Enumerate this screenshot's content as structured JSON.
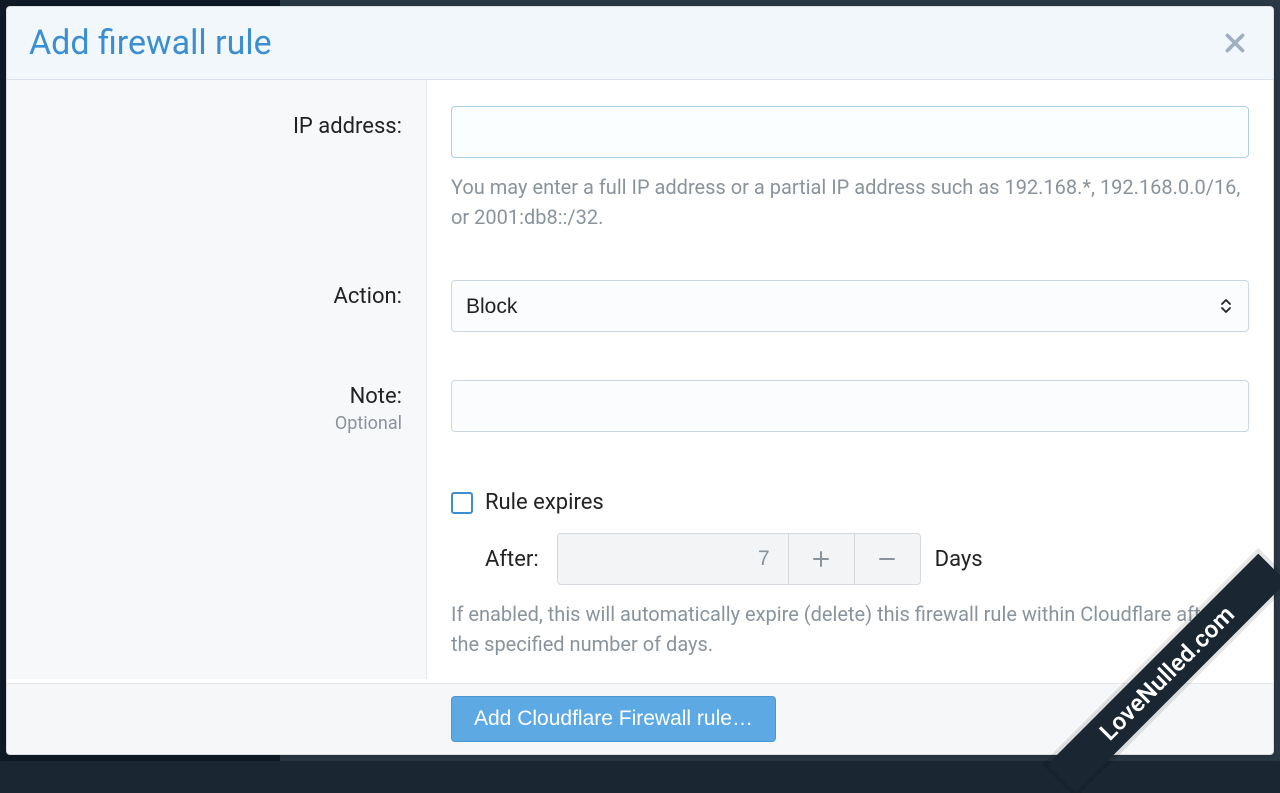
{
  "modal": {
    "title": "Add firewall rule"
  },
  "form": {
    "ip": {
      "label": "IP address:",
      "help": "You may enter a full IP address or a partial IP address such as 192.168.*, 192.168.0.0/16, or 2001:db8::/32."
    },
    "action": {
      "label": "Action:",
      "value": "Block"
    },
    "note": {
      "label": "Note:",
      "optional": "Optional"
    },
    "expires": {
      "checkbox_label": "Rule expires",
      "after_label": "After:",
      "value": "7",
      "unit": "Days",
      "help": "If enabled, this will automatically expire (delete) this firewall rule within Cloudflare after the specified number of days."
    }
  },
  "footer": {
    "submit": "Add Cloudflare Firewall rule…"
  },
  "watermark": "LoveNulled.com"
}
